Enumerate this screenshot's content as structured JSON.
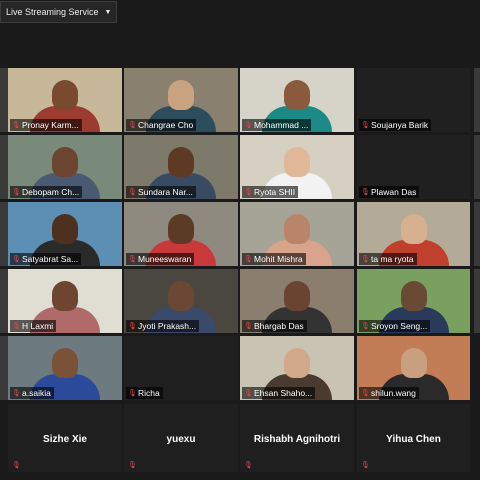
{
  "toolbar": {
    "stream_label": "Live Streaming Service",
    "caret": "▼"
  },
  "icons": {
    "muted_mic": "muted-mic-icon"
  },
  "participants": [
    {
      "name": "Pronay Karm...",
      "bg": "#c7b89a",
      "skin": "#7a4a30",
      "shirt": "#9c3b30"
    },
    {
      "name": "Changrae Cho",
      "bg": "#8a8070",
      "skin": "#c9a27f",
      "shirt": "#2d4c5c"
    },
    {
      "name": "Mohammad ...",
      "bg": "#d6d3c9",
      "skin": "#8a5a3c",
      "shirt": "#1b8a86"
    },
    {
      "name": "Soujanya Barik",
      "bg": "#202020",
      "skin": "",
      "shirt": ""
    },
    {
      "name": "Debopam Ch...",
      "bg": "#7a8a7a",
      "skin": "#6b4530",
      "shirt": "#4a5a72"
    },
    {
      "name": "Sundara Nar...",
      "bg": "#7d7a6b",
      "skin": "#5e3a25",
      "shirt": "#394b63"
    },
    {
      "name": "Ryota SHII",
      "bg": "#d5d0c2",
      "skin": "#e0b898",
      "shirt": "#f2f2f2"
    },
    {
      "name": "Plawan Das",
      "bg": "#202020",
      "skin": "",
      "shirt": ""
    },
    {
      "name": "Satyabrat Sa...",
      "bg": "#5d8fb4",
      "skin": "#4e3020",
      "shirt": "#2a2a2a"
    },
    {
      "name": "Muneeswaran",
      "bg": "#8f8a80",
      "skin": "#5b3b26",
      "shirt": "#c83a3a"
    },
    {
      "name": "Mohit Mishra",
      "bg": "#a6a397",
      "skin": "#b9856a",
      "shirt": "#d9a38c"
    },
    {
      "name": "ta ma ryota",
      "bg": "#b4aa98",
      "skin": "#d6b090",
      "shirt": "#c0402e"
    },
    {
      "name": "H Laxmi",
      "bg": "#e0ddd2",
      "skin": "#6d4530",
      "shirt": "#b06a6a"
    },
    {
      "name": "Jyoti Prakash...",
      "bg": "#4a4640",
      "skin": "#6b4836",
      "shirt": "#3a4a6a"
    },
    {
      "name": "Bhargab Das",
      "bg": "#8c7e6e",
      "skin": "#6a4430",
      "shirt": "#333333"
    },
    {
      "name": "Sroyon Seng...",
      "bg": "#7aa060",
      "skin": "#6a4a35",
      "shirt": "#2a3a5a"
    },
    {
      "name": "a.saikia",
      "bg": "#6d7a7f",
      "skin": "#7a5238",
      "shirt": "#2b4a9a"
    },
    {
      "name": "Richa",
      "bg": "#1f1f1f",
      "skin": "",
      "shirt": ""
    },
    {
      "name": "Ehsan Shaho...",
      "bg": "#c9c3b4",
      "skin": "#d2a88a",
      "shirt": "#4a3a30"
    },
    {
      "name": "shilun.wang",
      "bg": "#c27d56",
      "skin": "#c8a080",
      "shirt": "#2a2a2a"
    }
  ],
  "bottom_row": [
    {
      "name": "Sizhe Xie"
    },
    {
      "name": "yuexu"
    },
    {
      "name": "Rishabh Agnihotri"
    },
    {
      "name": "Yihua Chen"
    }
  ]
}
